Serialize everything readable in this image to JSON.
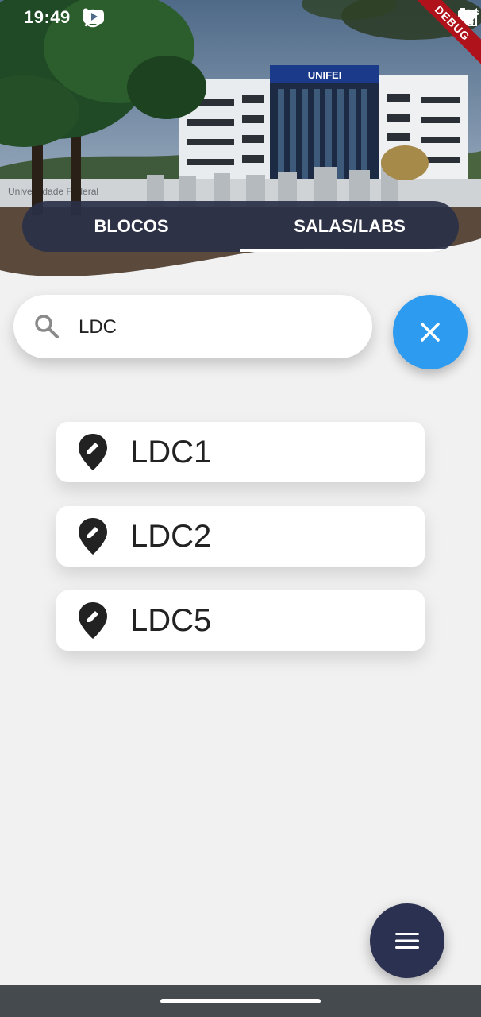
{
  "status_bar": {
    "time": "19:49",
    "debug_label": "DEBUG"
  },
  "header": {
    "sign_text": "UNIFEI",
    "wall_text": "Universidade Federal"
  },
  "tabs": [
    {
      "label": "BLOCOS",
      "active": false
    },
    {
      "label": "SALAS/LABS",
      "active": true
    }
  ],
  "search": {
    "value": "LDC",
    "placeholder": ""
  },
  "results": [
    {
      "label": "LDC1",
      "icon": "edit-location-icon"
    },
    {
      "label": "LDC2",
      "icon": "edit-location-icon"
    },
    {
      "label": "LDC5",
      "icon": "edit-location-icon"
    }
  ],
  "colors": {
    "accent_blue": "#2d9bf0",
    "navy": "#2b3150",
    "background": "#f1f1f1"
  }
}
